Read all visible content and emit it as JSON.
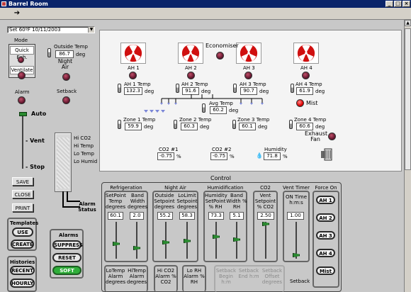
{
  "window": {
    "title": "Barrel Room"
  },
  "date_select": {
    "value": "Set 60ºF 10/11/2003"
  },
  "mode": {
    "title": "Mode",
    "quick_exh": "Quick Exh.",
    "ventilate": "Ventilate",
    "alarm": "Alarm",
    "setback": "Setback",
    "slider_auto": "Auto",
    "slider_vent": "- Vent",
    "slider_stop": "- Stop",
    "night_air": "Night Air",
    "outside_temp_label": "Outside Temp",
    "outside_temp_value": "86.7",
    "deg": "deg"
  },
  "status": {
    "items": [
      "Hi CO2",
      "Hi Temp",
      "Lo Temp",
      "Lo Humid"
    ],
    "alarm_status": "Alarm Status"
  },
  "left_buttons": {
    "save": "SAVE",
    "close": "CLOSE",
    "print": "PRINT"
  },
  "templates": {
    "title": "Templates",
    "use": "USE",
    "create": "CREATE"
  },
  "histories": {
    "title": "Histories",
    "recent": "RECENT",
    "hourly": "HOURLY"
  },
  "alarms": {
    "title": "Alarms",
    "suppress": "SUPPRESS",
    "reset": "RESET",
    "soft": "SOFT"
  },
  "economiser": "Economiser",
  "mist": "Mist",
  "exhaust_fan": "Exhaust Fan",
  "ahu": [
    {
      "name": "AH 1",
      "temp_label": "AH 1 Temp",
      "temp": "132.3"
    },
    {
      "name": "AH 2",
      "temp_label": "AH 2 Temp",
      "temp": "91.6"
    },
    {
      "name": "AH 3",
      "temp_label": "AH 3 Temp",
      "temp": "90.7"
    },
    {
      "name": "AH 4",
      "temp_label": "AH 4 Temp",
      "temp": "61.9"
    }
  ],
  "avg_temp": {
    "label": "Avg Temp",
    "value": "60.2"
  },
  "zones": [
    {
      "label": "Zone 1 Temp",
      "value": "59.9"
    },
    {
      "label": "Zone 2 Temp",
      "value": "60.3"
    },
    {
      "label": "Zone 3 Temp",
      "value": "60.1"
    },
    {
      "label": "Zone 4 Temp",
      "value": "60.6"
    }
  ],
  "co2_1": {
    "label": "CO2 #1",
    "value": "-0.75",
    "unit": "%"
  },
  "co2_2": {
    "label": "CO2 #2",
    "value": "-0.75",
    "unit": "%"
  },
  "humidity": {
    "label": "Humidity",
    "value": "71.8",
    "unit": "%"
  },
  "control": {
    "title": "Control",
    "refrigeration": {
      "title": "Refrigeration",
      "col1": "SetPoint Temp degrees",
      "col1_val": "60.1",
      "col2": "Band Width degrees",
      "col2_val": "2.0"
    },
    "night_air": {
      "title": "Night Air",
      "col1": "Outside Setpoint degrees",
      "col1_val": "55.2",
      "col2": "LoLimit Setpoint degrees",
      "col2_val": "58.3"
    },
    "humidification": {
      "title": "Humidification",
      "col1": "Humidity SetPoint % RH",
      "col1_val": "73.3",
      "col2": "Band Width % RH",
      "col2_val": "5.1"
    },
    "co2": {
      "title": "CO2",
      "col1": "Vent Setpoint % CO2",
      "col1_val": "2.50"
    },
    "vent_timer": {
      "title": "Vent Timer",
      "col1": "ON Time h:m:s",
      "col1_val": "1.00"
    },
    "force_on": {
      "title": "Force On",
      "items": [
        "AH 1",
        "AH 2",
        "AH 3",
        "AH 4",
        "Mist"
      ]
    },
    "bottom": {
      "lotemp": "LoTemp Alarm degrees",
      "hitemp": "HiTemp Alarm degrees",
      "hico2": "Hi CO2 Alarm % CO2",
      "lorh": "Lo RH Alarm % RH",
      "setback_begin": "Setback Begin h:m",
      "setback_end": "Setback End h:m",
      "setback_offset": "Setback Offset degrees",
      "setback": "Setback"
    }
  },
  "colors": {
    "accent_green": "#2fae3a",
    "title_bar": "#0a246a",
    "fan_red": "#d01010"
  }
}
